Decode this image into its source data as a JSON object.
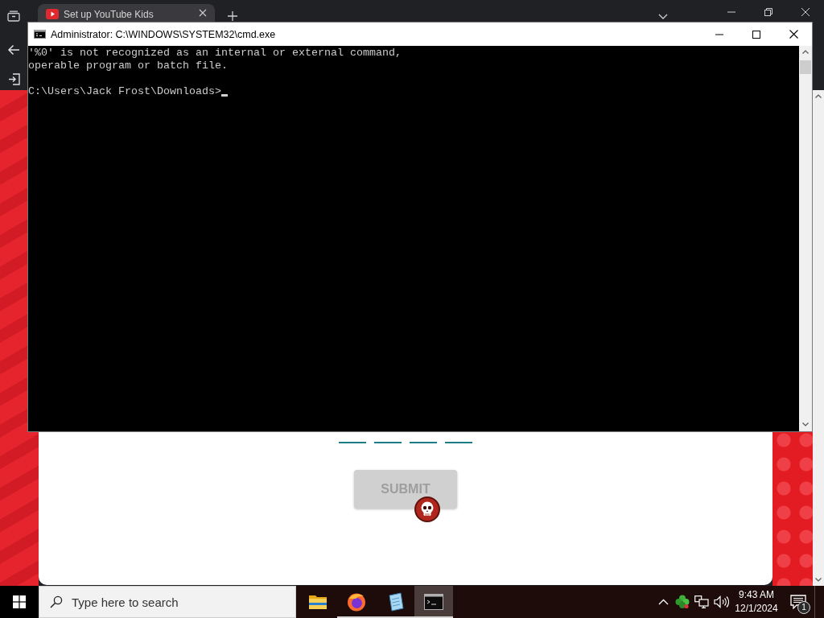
{
  "browser": {
    "tabs": [
      {
        "title": "Set up YouTube Kids",
        "selected": true
      }
    ]
  },
  "page": {
    "code_fields": [
      {
        "kind": "digit"
      },
      {
        "kind": "digit"
      },
      {
        "kind": "digit"
      },
      {
        "kind": "digit"
      }
    ],
    "submit_button": {
      "label": "SUBMIT",
      "disabled": true
    }
  },
  "console_window": {
    "title": "Administrator: C:\\WINDOWS\\SYSTEM32\\cmd.exe",
    "output": [
      "'%0' is not recognized as an internal or external command,",
      "operable program or batch file."
    ],
    "prompt": "C:\\Users\\Jack Frost\\Downloads>"
  },
  "taskbar": {
    "search": {
      "placeholder": "Type here to search"
    },
    "apps": [
      {
        "kind": "folder",
        "running": false,
        "selected": false
      },
      {
        "kind": "browser",
        "running": true,
        "selected": false
      },
      {
        "kind": "notepad",
        "running": true,
        "selected": false
      },
      {
        "kind": "terminal",
        "running": true,
        "selected": true
      }
    ],
    "clock": {
      "time": "9:43 AM",
      "date": "12/1/2024"
    },
    "notifications": {
      "badge": "1"
    }
  }
}
